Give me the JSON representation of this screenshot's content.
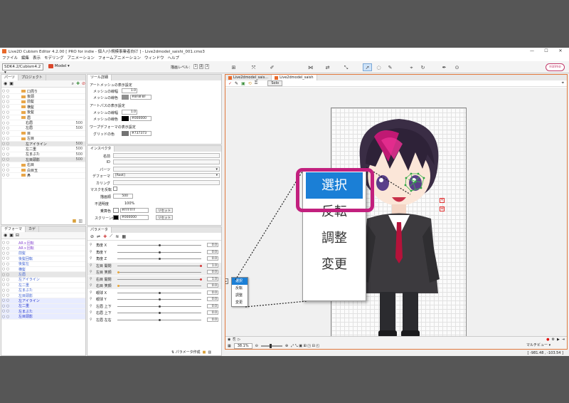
{
  "window": {
    "title": "Live2D Cubism Editor 4.2.00   [ PRO for indie - 個人/小規模事業者向け ]  - Live2dmodel_saishi_001.cmo3",
    "controls": [
      "—",
      "☐",
      "✕"
    ]
  },
  "menu": [
    "ファイル",
    "編集",
    "表示",
    "モデリング",
    "アニメーション",
    "フォームアニメーション",
    "ウィンドウ",
    "ヘルプ"
  ],
  "toolbar": {
    "sdk_version": "SDK4.2/Cubism4.2",
    "model_select": "Model",
    "quality_label": "描画レベル：",
    "quality_levels": [
      "1",
      "2",
      "3"
    ],
    "brand": "nizimo"
  },
  "parts_panel": {
    "tabs": [
      "パーツ",
      "プロジェクト"
    ],
    "rows": [
      {
        "label": "口周り",
        "value": ""
      },
      {
        "label": "後頭",
        "value": ""
      },
      {
        "label": "前髪",
        "value": ""
      },
      {
        "label": "横髪",
        "value": ""
      },
      {
        "label": "後髪",
        "value": ""
      },
      {
        "label": "眉",
        "value": ""
      },
      {
        "label": "右眉",
        "value": "500"
      },
      {
        "label": "左眉",
        "value": "500"
      },
      {
        "label": "目",
        "value": ""
      },
      {
        "label": "左目",
        "value": ""
      },
      {
        "label": "左アイライン",
        "value": "500"
      },
      {
        "label": "左二重",
        "value": "500"
      },
      {
        "label": "左まぶた",
        "value": "500"
      },
      {
        "label": "左目頭影",
        "value": "500"
      },
      {
        "label": "右目",
        "value": ""
      },
      {
        "label": "白目玉",
        "value": ""
      },
      {
        "label": "鼻",
        "value": ""
      }
    ]
  },
  "tool_settings": {
    "tab": "ツール詳細",
    "art_mesh_header": "アートメッシュの表示設定",
    "mesh_width_label": "メッシュの線幅",
    "mesh_width": "1.0",
    "mesh_color_label": "メッシュの線色",
    "mesh_color": "#8F8F8F",
    "art_path_header": "アートパスの表示設定",
    "path_width_label": "メッシュの線幅",
    "path_width": "1.0",
    "path_color_label": "メッシュの線色",
    "path_color": "#000000",
    "warp_header": "ワープデフォーマの表示設定",
    "grid_color_label": "グリッドの色",
    "grid_color": "#737373"
  },
  "inspector": {
    "tab": "インスペクタ",
    "name_label": "名前",
    "id_label": "ID",
    "id_value": "",
    "parts_label": "パーツ",
    "deformer_label": "デフォーマ",
    "deformer_value": "[Root]",
    "culling_label": "カリング",
    "mask_label": "マスクを反転",
    "draw_order_label": "描画順",
    "draw_order": "500",
    "opacity_label": "不透明度",
    "opacity": "100%",
    "multiply_label": "乗算色",
    "multiply_color": "#FFFFFF",
    "screen_label": "スクリーン色",
    "screen_color": "#000000",
    "reset_label": "リセット"
  },
  "deformer_panel": {
    "tabs": [
      "デフォーマ",
      "カゲ"
    ],
    "rows": [
      "ARｘ回転",
      "ARｘ回転",
      "前髪",
      "後髪回転",
      "後髪左",
      "横髪",
      "左眉",
      "左アイライン",
      "左二重",
      "左まぶた",
      "左目頭影",
      "左アイライン",
      "左二重",
      "左まぶた",
      "左目頭影"
    ]
  },
  "parameters": {
    "tab": "パラメータ",
    "rows": [
      {
        "name": "角度 X",
        "value": "0.0",
        "pos": 0.5
      },
      {
        "name": "角度 Y",
        "value": "0.0",
        "pos": 0.5
      },
      {
        "name": "角度 Z",
        "value": "0.0",
        "pos": 0.5
      },
      {
        "name": "左目 開閉",
        "value": "1.0",
        "pos": 1.0
      },
      {
        "name": "左目 笑顔",
        "value": "0.0",
        "pos": 0.0
      },
      {
        "name": "右目 開閉",
        "value": "1.0",
        "pos": 1.0
      },
      {
        "name": "右目 笑顔",
        "value": "0.0",
        "pos": 0.0
      },
      {
        "name": "眼球 X",
        "value": "0.0",
        "pos": 0.5
      },
      {
        "name": "眼球 Y",
        "value": "0.0",
        "pos": 0.5
      },
      {
        "name": "左眉 上下",
        "value": "0.0",
        "pos": 0.5
      },
      {
        "name": "右眉 上下",
        "value": "0.0",
        "pos": 0.5
      },
      {
        "name": "左眉 左右",
        "value": "0.0",
        "pos": 0.5
      }
    ],
    "create_label": "パラメータ作成"
  },
  "viewport": {
    "tabs": [
      "Live2dmodel_sais...",
      "Live2dmodel_saish"
    ],
    "solo_label": "Solo",
    "zoom": "38.1%",
    "coords": "[ -981.48 , -103.54 ]",
    "multi_view": "マルチビュー"
  },
  "context_menu": {
    "items": [
      "選択",
      "反転",
      "調整",
      "変更"
    ]
  },
  "callout": {
    "items": [
      "選択",
      "反転",
      "調整",
      "変更"
    ],
    "highlight_color": "#c2207e"
  }
}
